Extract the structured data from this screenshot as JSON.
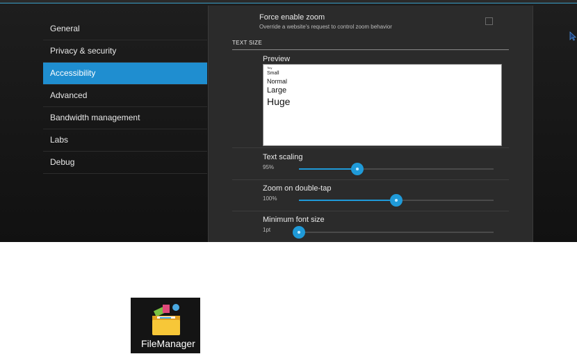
{
  "sidebar": {
    "items": [
      {
        "label": "General"
      },
      {
        "label": "Privacy & security"
      },
      {
        "label": "Accessibility"
      },
      {
        "label": "Advanced"
      },
      {
        "label": "Bandwidth management"
      },
      {
        "label": "Labs"
      },
      {
        "label": "Debug"
      }
    ],
    "active_index": 2
  },
  "force_zoom": {
    "title": "Force enable zoom",
    "summary": "Override a website's request to control zoom behavior",
    "checked": false
  },
  "text_size": {
    "header": "TEXT SIZE",
    "preview_label": "Preview",
    "preview_samples": [
      "Tiny",
      "Small",
      "Normal",
      "Large",
      "Huge"
    ],
    "text_scaling": {
      "title": "Text scaling",
      "value": "95%",
      "fraction": 0.3
    },
    "zoom_double_tap": {
      "title": "Zoom on double-tap",
      "value": "100%",
      "fraction": 0.5
    },
    "min_font_size": {
      "title": "Minimum font size",
      "value": "1pt",
      "fraction": 0.0
    }
  },
  "desktop": {
    "app_label": "FileManager"
  },
  "colors": {
    "accent": "#1f8ed0",
    "slider": "#1f9ad8"
  }
}
